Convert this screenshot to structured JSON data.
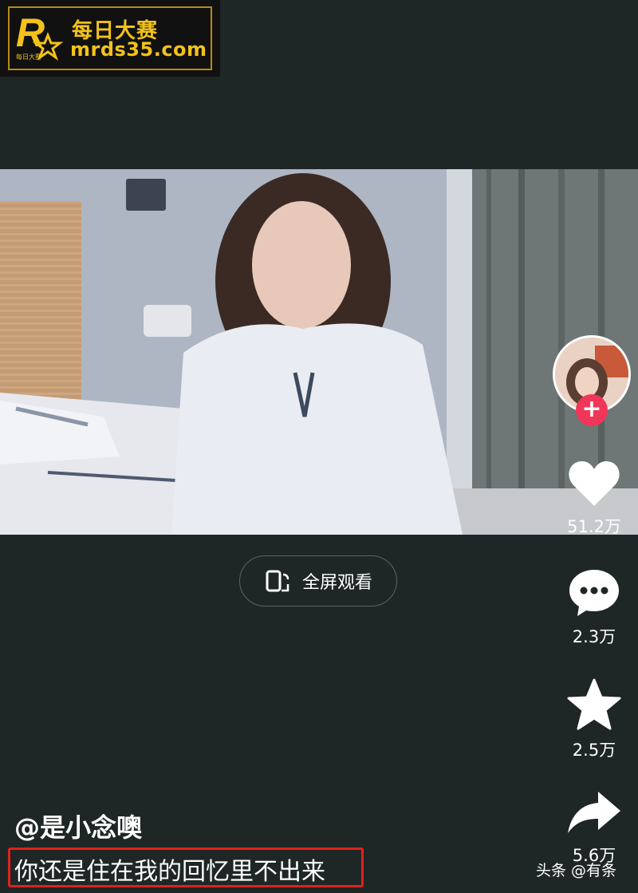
{
  "watermark": {
    "brand_zh": "每日大赛",
    "url": "mrds35.com",
    "mark_letter": "R",
    "mark_small": "每日大赛",
    "color": "#f2c21b"
  },
  "video": {
    "fullscreen_label": "全屏观看"
  },
  "actions": {
    "like_count": "51.2万",
    "comment_count": "2.3万",
    "favorite_count": "2.5万",
    "share_count": "5.6万",
    "follow_symbol": "+"
  },
  "post": {
    "author": "@是小念噢",
    "caption": "你还是住在我的回忆里不出来"
  },
  "source_watermark": "头条 @有条",
  "colors": {
    "background": "#1f2626",
    "highlight_box": "#e0211b",
    "follow_button": "#f0375a"
  }
}
